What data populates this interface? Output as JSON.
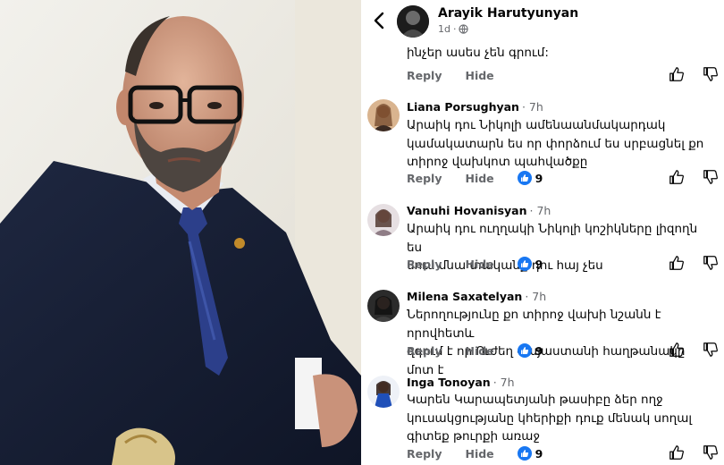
{
  "post": {
    "author": "Arayik Harutyunyan",
    "age": "1d",
    "privacy_icon": "globe-icon"
  },
  "partial_comment": {
    "text": "ինչեր ասես չեն գրում:",
    "reply": "Reply",
    "hide": "Hide"
  },
  "comments": [
    {
      "name": "Liana Porsughyan",
      "time": "· 7h",
      "lines": [
        "Արաիկ դու Նիկոլի ամենաանմակարդակ",
        "կամակատարն ես որ փորձում ես սրբացնել քո",
        "տիրոջ վախկոտ պահվածքը"
      ],
      "reply": "Reply",
      "hide": "Hide",
      "likes": "9"
    },
    {
      "name": "Vanuhi Hovanisyan",
      "time": "· 7h",
      "lines": [
        "Արաիկ դու ուղղակի Նիկոլի կոշիկները լիզողն ես",
        "սուս մնա տականք դու հայ չես"
      ],
      "reply": "Reply",
      "hide": "Hide",
      "likes": "9"
    },
    {
      "name": "Milena Saxatelyan",
      "time": "· 7h",
      "lines": [
        "Ներողությունը քո տիրոջ վախի նշանն է որովհետև",
        "զգում է որ Ուժեղ Հայաստանի հաղթանակը մոտ է"
      ],
      "reply": "Reply",
      "hide": "Hide",
      "likes": "9"
    },
    {
      "name": "Inga Tonoyan",
      "time": "· 7h",
      "lines": [
        "Կարեն Կարապետյանի թասիբը ձեր ողջ",
        "կուսակցությանը կհերիքի դուք մենակ սողալ",
        "գիտեք թուրքի առաջ"
      ],
      "reply": "Reply",
      "hide": "Hide",
      "likes": "9"
    }
  ],
  "colors": {
    "like_blue": "#1877f2",
    "meta_gray": "#65676b",
    "text_black": "#050505"
  }
}
